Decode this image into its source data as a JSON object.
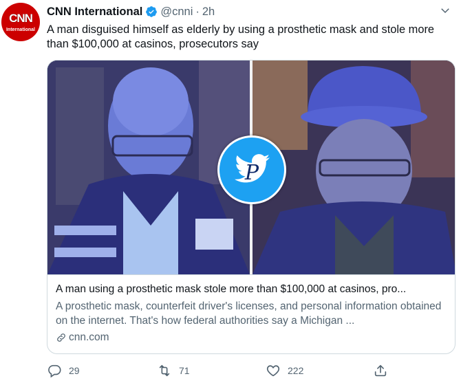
{
  "account": {
    "name": "CNN International",
    "handle": "@cnni",
    "dot": "·",
    "time": "2h",
    "avatar_logo": "CNN",
    "avatar_sub": "International"
  },
  "tweet": {
    "text": "A man disguised himself as elderly by using a prosthetic mask and stole more than $100,000 at casinos, prosecutors say"
  },
  "card": {
    "title": "A man using a prosthetic mask stole more than $100,000 at casinos, pro...",
    "description": "A prosthetic mask, counterfeit driver's licenses, and personal information obtained on the internet. That's how federal authorities say a Michigan ...",
    "domain": "cnn.com",
    "badge_letter": "P"
  },
  "actions": {
    "replies": "29",
    "retweets": "71",
    "likes": "222"
  },
  "colors": {
    "text": "#0f1419",
    "muted": "#536471",
    "border": "#cfd9de",
    "verified": "#1d9bf0",
    "twitter_blue": "#1da1f2"
  },
  "icons": [
    "verified-badge-icon",
    "chevron-down-icon",
    "link-icon",
    "reply-icon",
    "retweet-icon",
    "like-icon",
    "share-icon",
    "twitter-bird-icon"
  ]
}
